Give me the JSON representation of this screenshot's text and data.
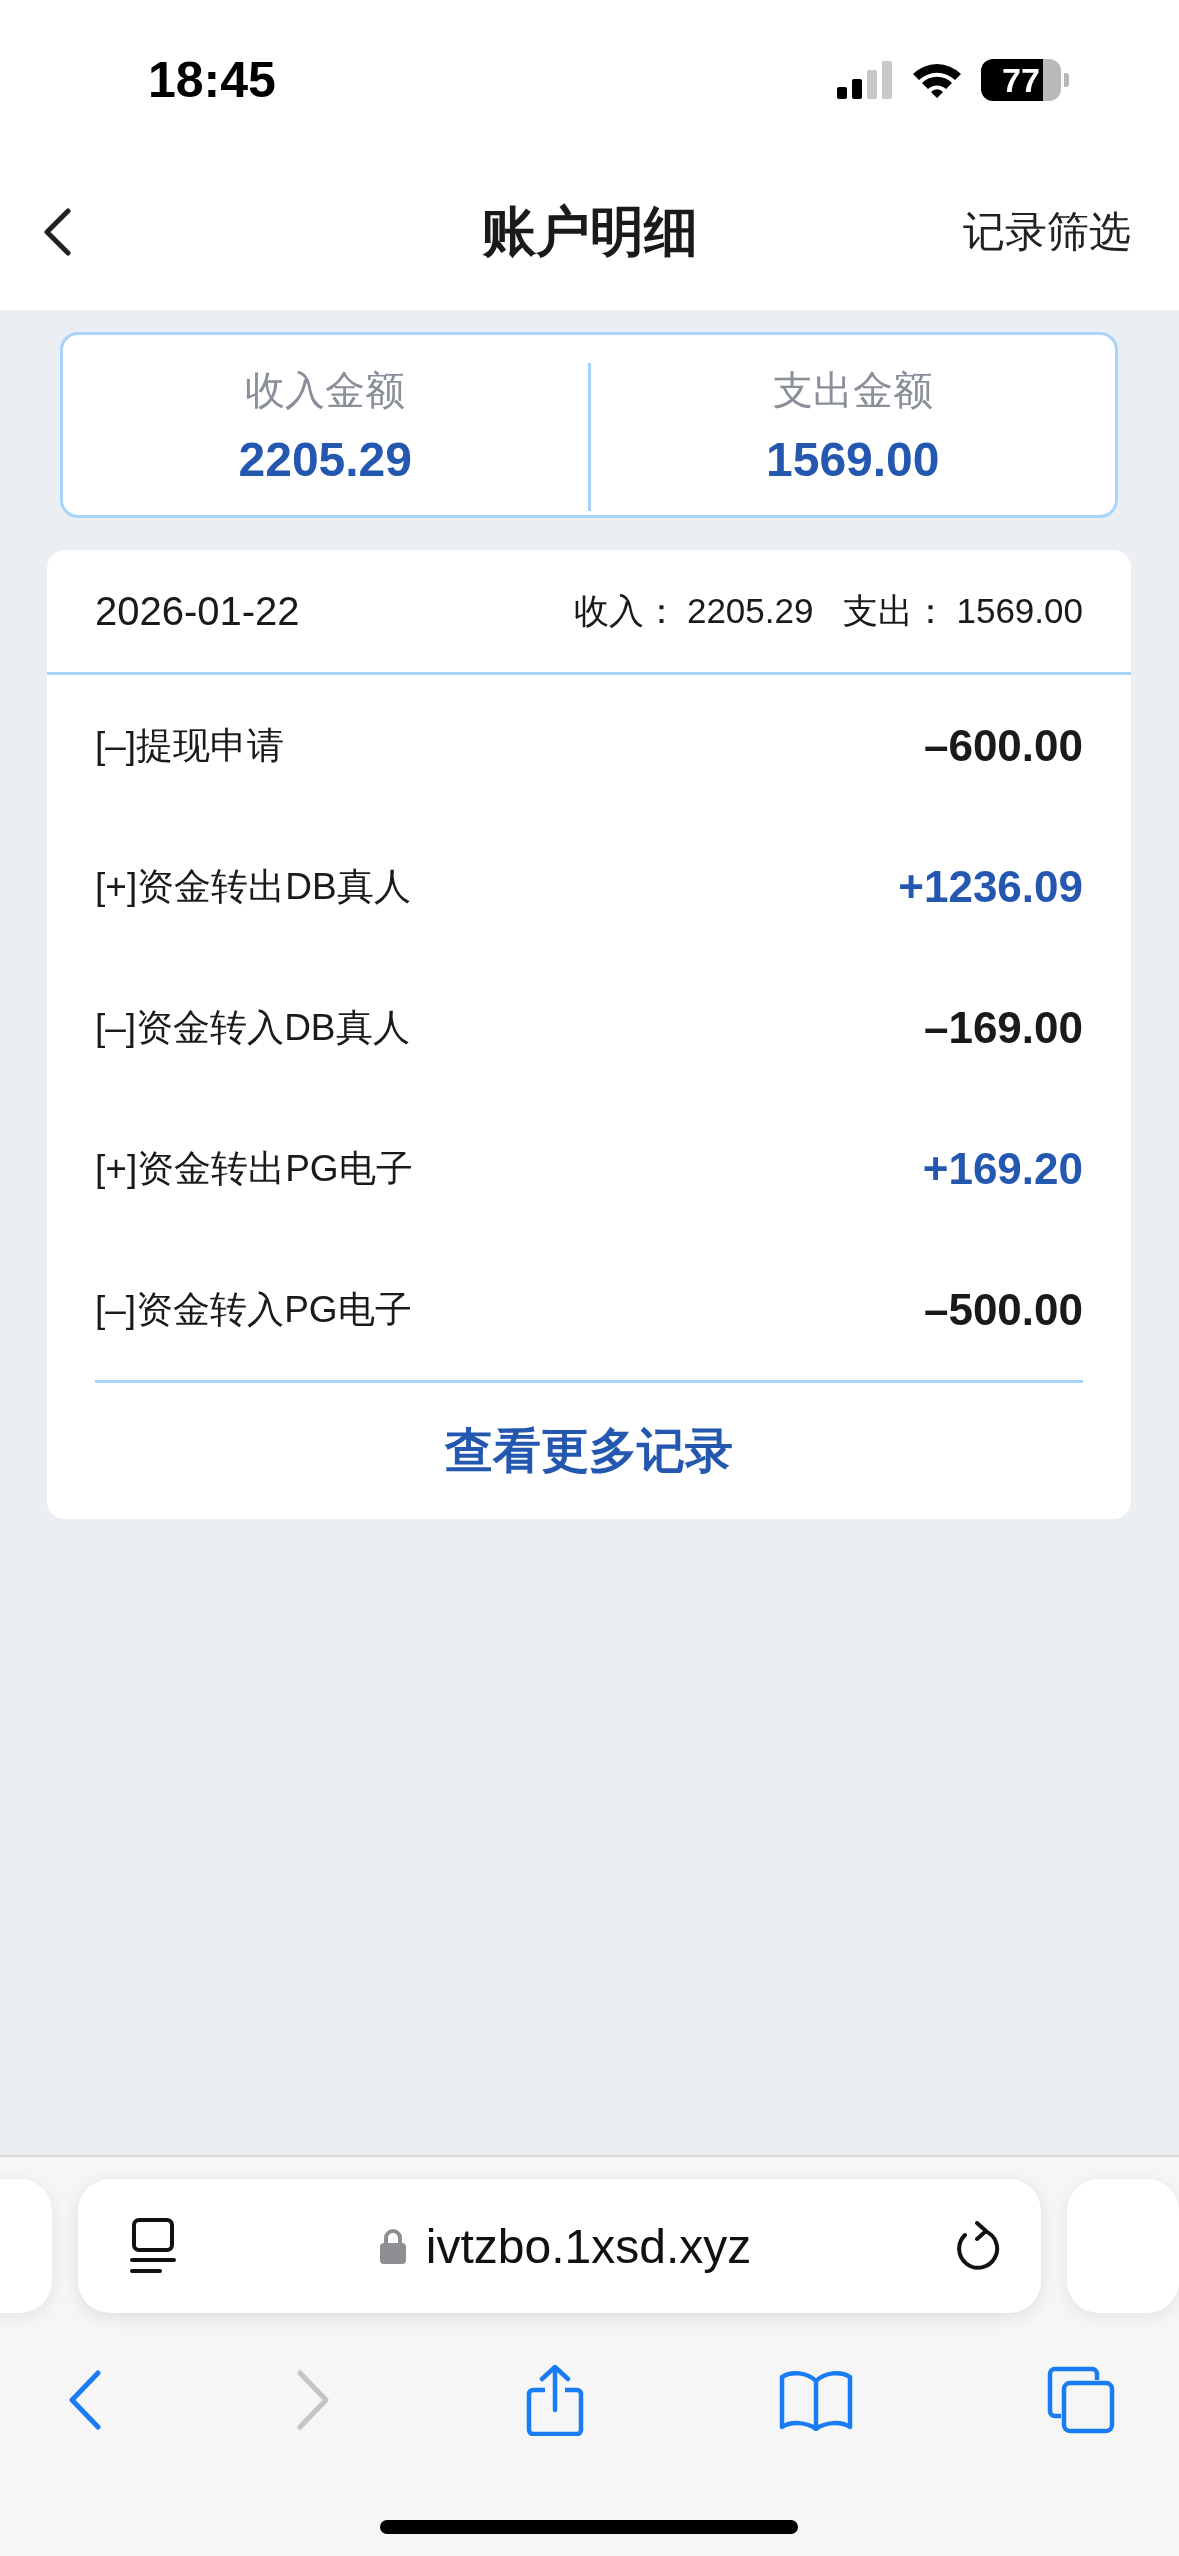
{
  "status_bar": {
    "time": "18:45",
    "battery": "77"
  },
  "nav": {
    "title": "账户明细",
    "action": "记录筛选"
  },
  "summary": [
    {
      "label": "收入金额",
      "value": "2205.29"
    },
    {
      "label": "支出金额",
      "value": "1569.00"
    }
  ],
  "day": {
    "date": "2026-01-22",
    "income_label": "收入：",
    "income": "2205.29",
    "expense_label": "支出：",
    "expense": "1569.00"
  },
  "records": [
    {
      "title": "[–]提现申请",
      "amount": "–600.00",
      "kind": "expense"
    },
    {
      "title": "[+]资金转出DB真人",
      "amount": "+1236.09",
      "kind": "income"
    },
    {
      "title": "[–]资金转入DB真人",
      "amount": "–169.00",
      "kind": "expense"
    },
    {
      "title": "[+]资金转出PG电子",
      "amount": "+169.20",
      "kind": "income"
    },
    {
      "title": "[–]资金转入PG电子",
      "amount": "–500.00",
      "kind": "expense"
    }
  ],
  "more_link": "查看更多记录",
  "browser": {
    "url": "ivtzbo.1xsd.xyz",
    "toolbar": [
      {
        "kind": "back",
        "disabled": false
      },
      {
        "kind": "forward",
        "disabled": true
      },
      {
        "kind": "share",
        "disabled": false
      },
      {
        "kind": "bookmarks",
        "disabled": false
      },
      {
        "kind": "tabs",
        "disabled": false
      }
    ]
  }
}
